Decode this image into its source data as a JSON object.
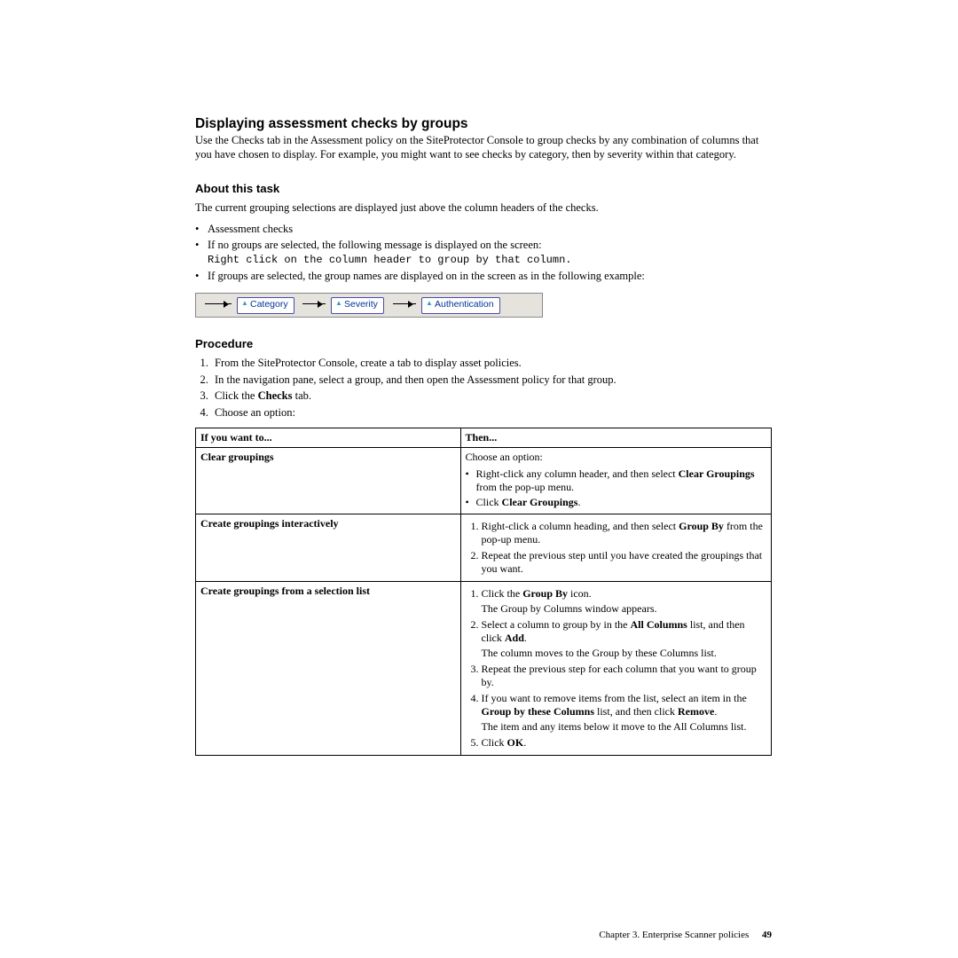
{
  "title": "Displaying assessment checks by groups",
  "intro": "Use the Checks tab in the Assessment policy on the SiteProtector Console to group checks by any combination of columns that you have chosen to display. For example, you might want to see checks by category, then by severity within that category.",
  "about": {
    "heading": "About this task",
    "lead": "The current grouping selections are displayed just above the column headers of the checks.",
    "b1": "Assessment checks",
    "b2": "If no groups are selected, the following message is displayed on the screen:",
    "b2code": "Right click on the column header to group by that column.",
    "b3": "If groups are selected, the group names are displayed on in the screen as in the following example:"
  },
  "crumbs": {
    "c1": "Category",
    "c2": "Severity",
    "c3": "Authentication"
  },
  "procedure": {
    "heading": "Procedure",
    "s1": "From the SiteProtector Console, create a tab to display asset policies.",
    "s2": "In the navigation pane, select a group, and then open the Assessment policy for that group.",
    "s3_pre": "Click the ",
    "s3_bold": "Checks",
    "s3_post": " tab.",
    "s4": "Choose an option:"
  },
  "table": {
    "h1": "If you want to...",
    "h2": "Then...",
    "r1": {
      "label": "Clear groupings",
      "pre": "Choose an option:",
      "b1a": "Right-click any column header, and then select ",
      "b1b": "Clear Groupings",
      "b1c": " from the pop-up menu.",
      "b2a": "Click ",
      "b2b": "Clear Groupings",
      "b2c": "."
    },
    "r2": {
      "label": "Create groupings interactively",
      "s1a": "Right-click a column heading, and then select ",
      "s1b": "Group By",
      "s1c": " from the pop-up menu.",
      "s2": "Repeat the previous step until you have created the groupings that you want."
    },
    "r3": {
      "label": "Create groupings from a selection list",
      "s1a": "Click the ",
      "s1b": "Group By",
      "s1c": " icon.",
      "s1sub": "The Group by Columns window appears.",
      "s2a": "Select a column to group by in the ",
      "s2b": "All Columns",
      "s2c": " list, and then click ",
      "s2d": "Add",
      "s2e": ".",
      "s2sub": "The column moves to the Group by these Columns list.",
      "s3": "Repeat the previous step for each column that you want to group by.",
      "s4a": "If you want to remove items from the list, select an item in the ",
      "s4b": "Group by these Columns",
      "s4c": " list, and then click ",
      "s4d": "Remove",
      "s4e": ".",
      "s4sub": "The item and any items below it move to the All Columns list.",
      "s5a": "Click ",
      "s5b": "OK",
      "s5c": "."
    }
  },
  "footer": {
    "chapter": "Chapter 3. Enterprise Scanner policies",
    "page": "49"
  }
}
